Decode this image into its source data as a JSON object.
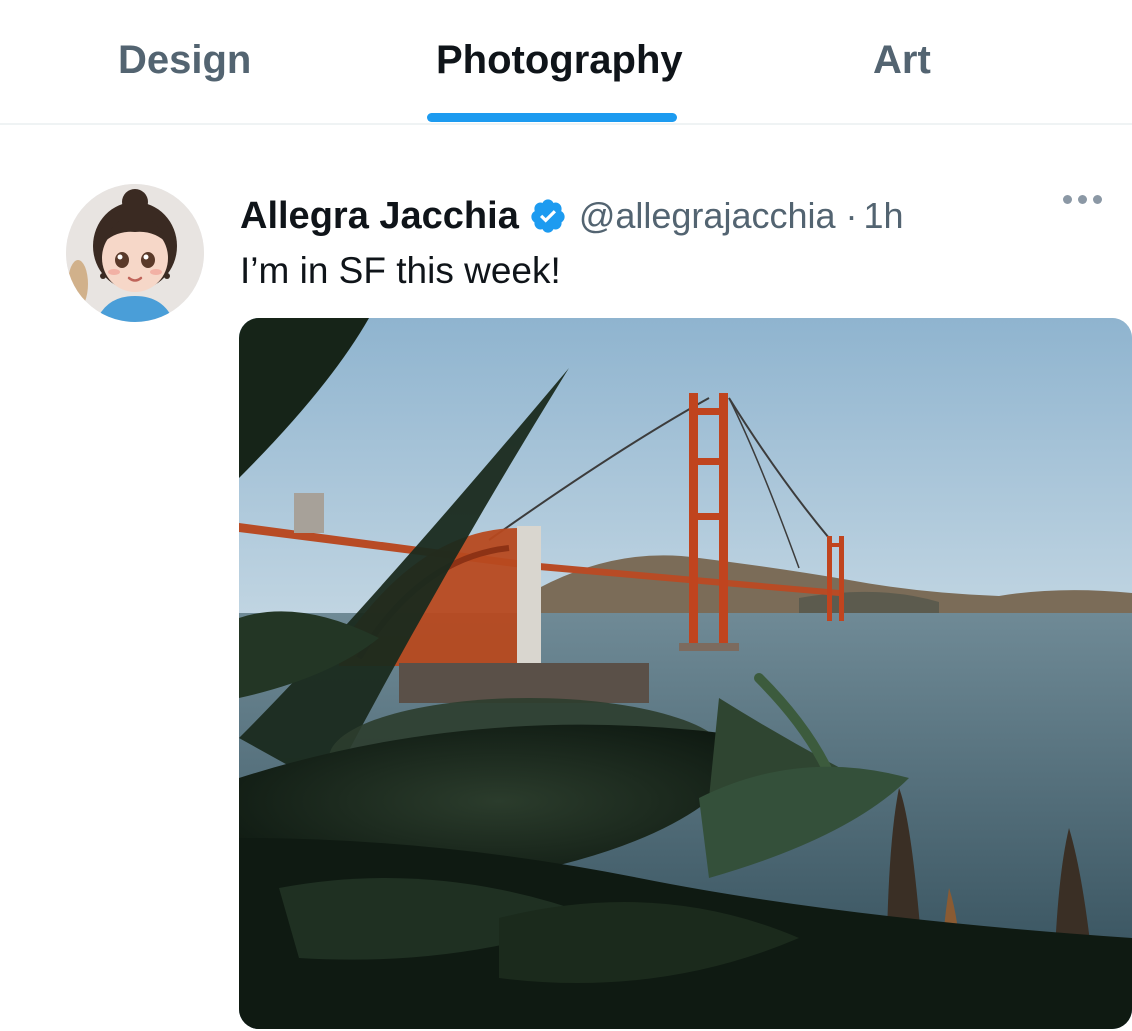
{
  "tabs": [
    {
      "label": "Design",
      "active": false
    },
    {
      "label": "Photography",
      "active": true
    },
    {
      "label": "Art",
      "active": false
    }
  ],
  "accent_color": "#1d9bf0",
  "tweet": {
    "display_name": "Allegra Jacchia",
    "verified": true,
    "handle": "@allegrajacchia",
    "separator": "·",
    "time": "1h",
    "text": "I’m in SF this week!",
    "avatar_icon": "cartoon-avatar",
    "more_icon": "more-horizontal-icon",
    "media_description_icon": "golden-gate-bridge-photo"
  }
}
